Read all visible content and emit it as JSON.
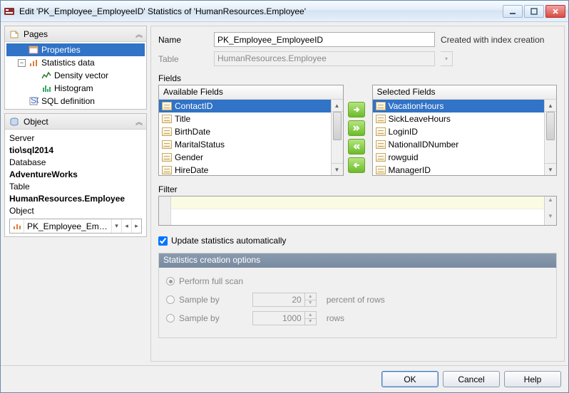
{
  "window": {
    "title": "Edit 'PK_Employee_EmployeeID' Statistics of 'HumanResources.Employee'"
  },
  "pages_panel": {
    "title": "Pages"
  },
  "tree": {
    "properties": "Properties",
    "stats": "Statistics data",
    "density": "Density vector",
    "histogram": "Histogram",
    "sqldef": "SQL definition"
  },
  "object_panel": {
    "title": "Object",
    "server_lbl": "Server",
    "server_val": "tio\\sql2014",
    "database_lbl": "Database",
    "database_val": "AdventureWorks",
    "table_lbl": "Table",
    "table_val": "HumanResources.Employee",
    "object_lbl": "Object",
    "object_val": "PK_Employee_Emplo..."
  },
  "form": {
    "name_lbl": "Name",
    "name_val": "PK_Employee_EmployeeID",
    "name_trail": "Created with index creation",
    "table_lbl": "Table",
    "table_val": "HumanResources.Employee",
    "fields_lbl": "Fields",
    "avail_hdr": "Available Fields",
    "sel_hdr": "Selected Fields",
    "available": [
      "ContactID",
      "Title",
      "BirthDate",
      "MaritalStatus",
      "Gender",
      "HireDate"
    ],
    "selected": [
      "VacationHours",
      "SickLeaveHours",
      "LoginID",
      "NationalIDNumber",
      "rowguid",
      "ManagerID"
    ],
    "filter_lbl": "Filter",
    "update_chk": "Update statistics automatically"
  },
  "group": {
    "title": "Statistics creation options",
    "opt_full": "Perform full scan",
    "opt_sample1": "Sample by",
    "opt_sample1_val": "20",
    "opt_sample1_unit": "percent of rows",
    "opt_sample2": "Sample by",
    "opt_sample2_val": "1000",
    "opt_sample2_unit": "rows"
  },
  "buttons": {
    "ok": "OK",
    "cancel": "Cancel",
    "help": "Help"
  }
}
